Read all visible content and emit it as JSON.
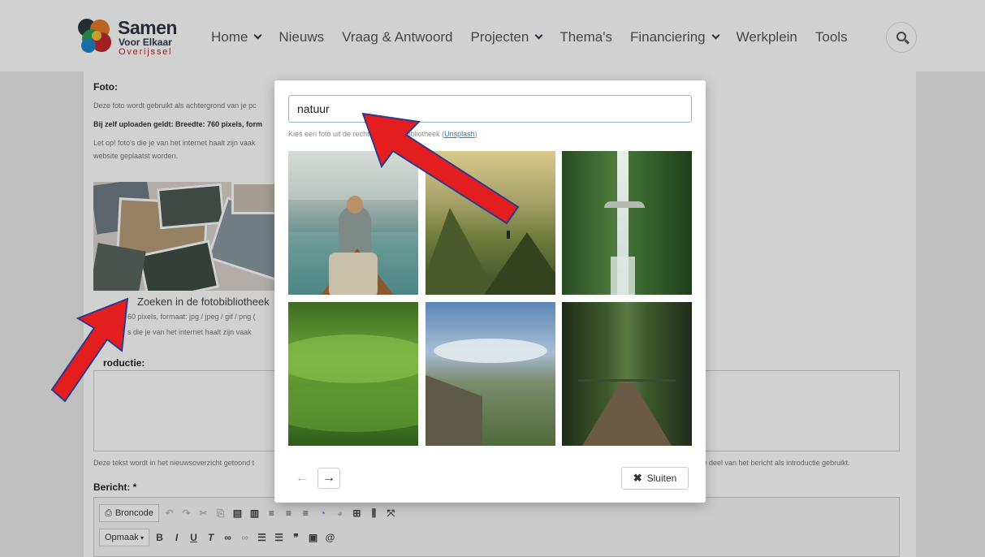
{
  "logo": {
    "line1": "Samen",
    "line2": "Voor Elkaar",
    "line3": "Overijssel"
  },
  "nav": [
    {
      "label": "Home",
      "dropdown": true
    },
    {
      "label": "Nieuws",
      "dropdown": false
    },
    {
      "label": "Vraag & Antwoord",
      "dropdown": false
    },
    {
      "label": "Projecten",
      "dropdown": true
    },
    {
      "label": "Thema's",
      "dropdown": false
    },
    {
      "label": "Financiering",
      "dropdown": true
    },
    {
      "label": "Werkplein",
      "dropdown": false
    },
    {
      "label": "Tools",
      "dropdown": false
    }
  ],
  "form": {
    "foto_label": "Foto:",
    "foto_help1": "Deze foto wordt gebruikt als achtergrond van je pc",
    "foto_help2": "Bij zelf uploaden geldt: Breedte: 760 pixels, form",
    "foto_help3": "Let op! foto's die je van het internet haalt zijn vaak",
    "foto_help4": "website geplaatst worden.",
    "foto_link": "Zoeken in de fotobibliotheek",
    "foto_help5": "60 pixels, formaat: jpg / jpeg / gif / png (",
    "foto_help6": "s die je van het internet haalt zijn vaak",
    "intro_label": "roductie:",
    "intro_help_left": "Deze tekst wordt in het nieuwsoverzicht getoond t",
    "intro_help_right": "te deel van het bericht als introductie gebruikt.",
    "bericht_label": "Bericht: *",
    "toolbar": {
      "broncode": "Broncode",
      "opmaak": "Opmaak"
    }
  },
  "modal": {
    "search_value": "natuur",
    "help_prefix": "Kies een foto uit de ",
    "help_middle": "rechtenvrije fotobibliotheek (",
    "help_link": "Unsplash",
    "help_suffix": ")",
    "photos": [
      {
        "subject": "kayak-lake"
      },
      {
        "subject": "mountain-sunset"
      },
      {
        "subject": "waterfall-bridge"
      },
      {
        "subject": "green-hills"
      },
      {
        "subject": "mountain-valley-clouds"
      },
      {
        "subject": "forest-footbridge"
      }
    ],
    "close_label": "Sluiten",
    "prev_icon": "←",
    "next_icon": "→"
  },
  "annotations": {
    "arrow_color": "#e41e1e",
    "arrow_outline": "#2c3a8c"
  }
}
